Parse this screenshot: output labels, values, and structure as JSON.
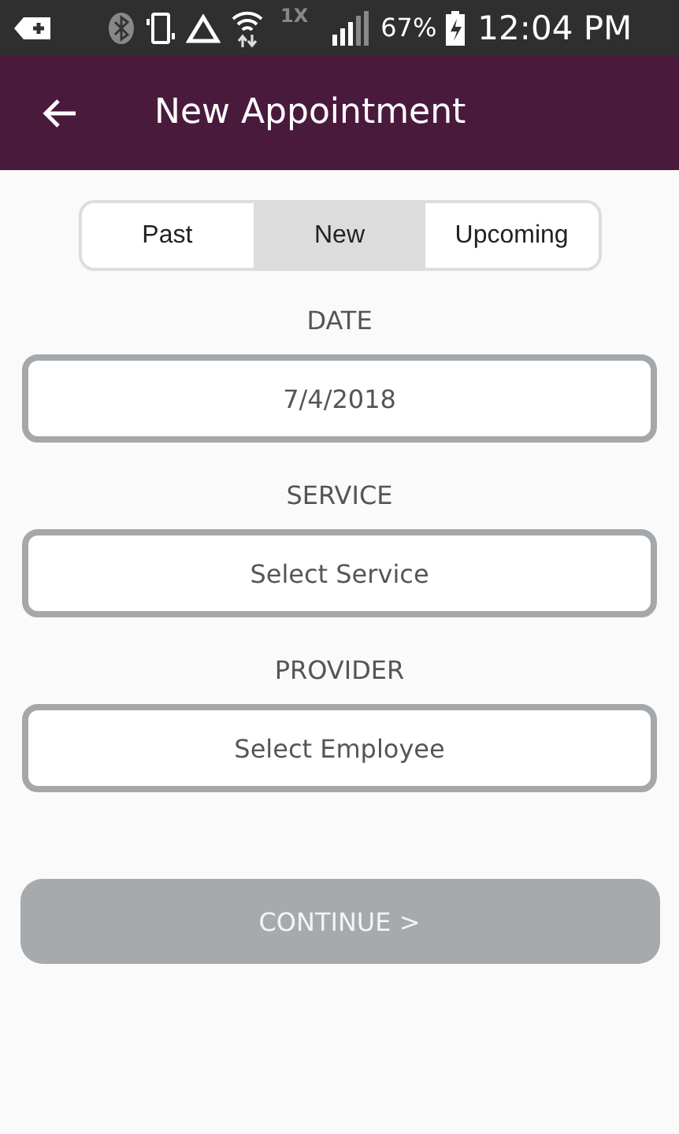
{
  "status_bar": {
    "network_label": "1X",
    "battery": "67%",
    "time": "12:04 PM"
  },
  "app_bar": {
    "title": "New Appointment"
  },
  "tabs": [
    {
      "label": "Past",
      "selected": false
    },
    {
      "label": "New",
      "selected": true
    },
    {
      "label": "Upcoming",
      "selected": false
    }
  ],
  "fields": [
    {
      "label": "DATE",
      "value": "7/4/2018"
    },
    {
      "label": "SERVICE",
      "placeholder": "Select Service"
    },
    {
      "label": "PROVIDER",
      "placeholder": "Select Employee"
    }
  ],
  "continue_button": {
    "label": "CONTINUE >",
    "disabled": true
  }
}
